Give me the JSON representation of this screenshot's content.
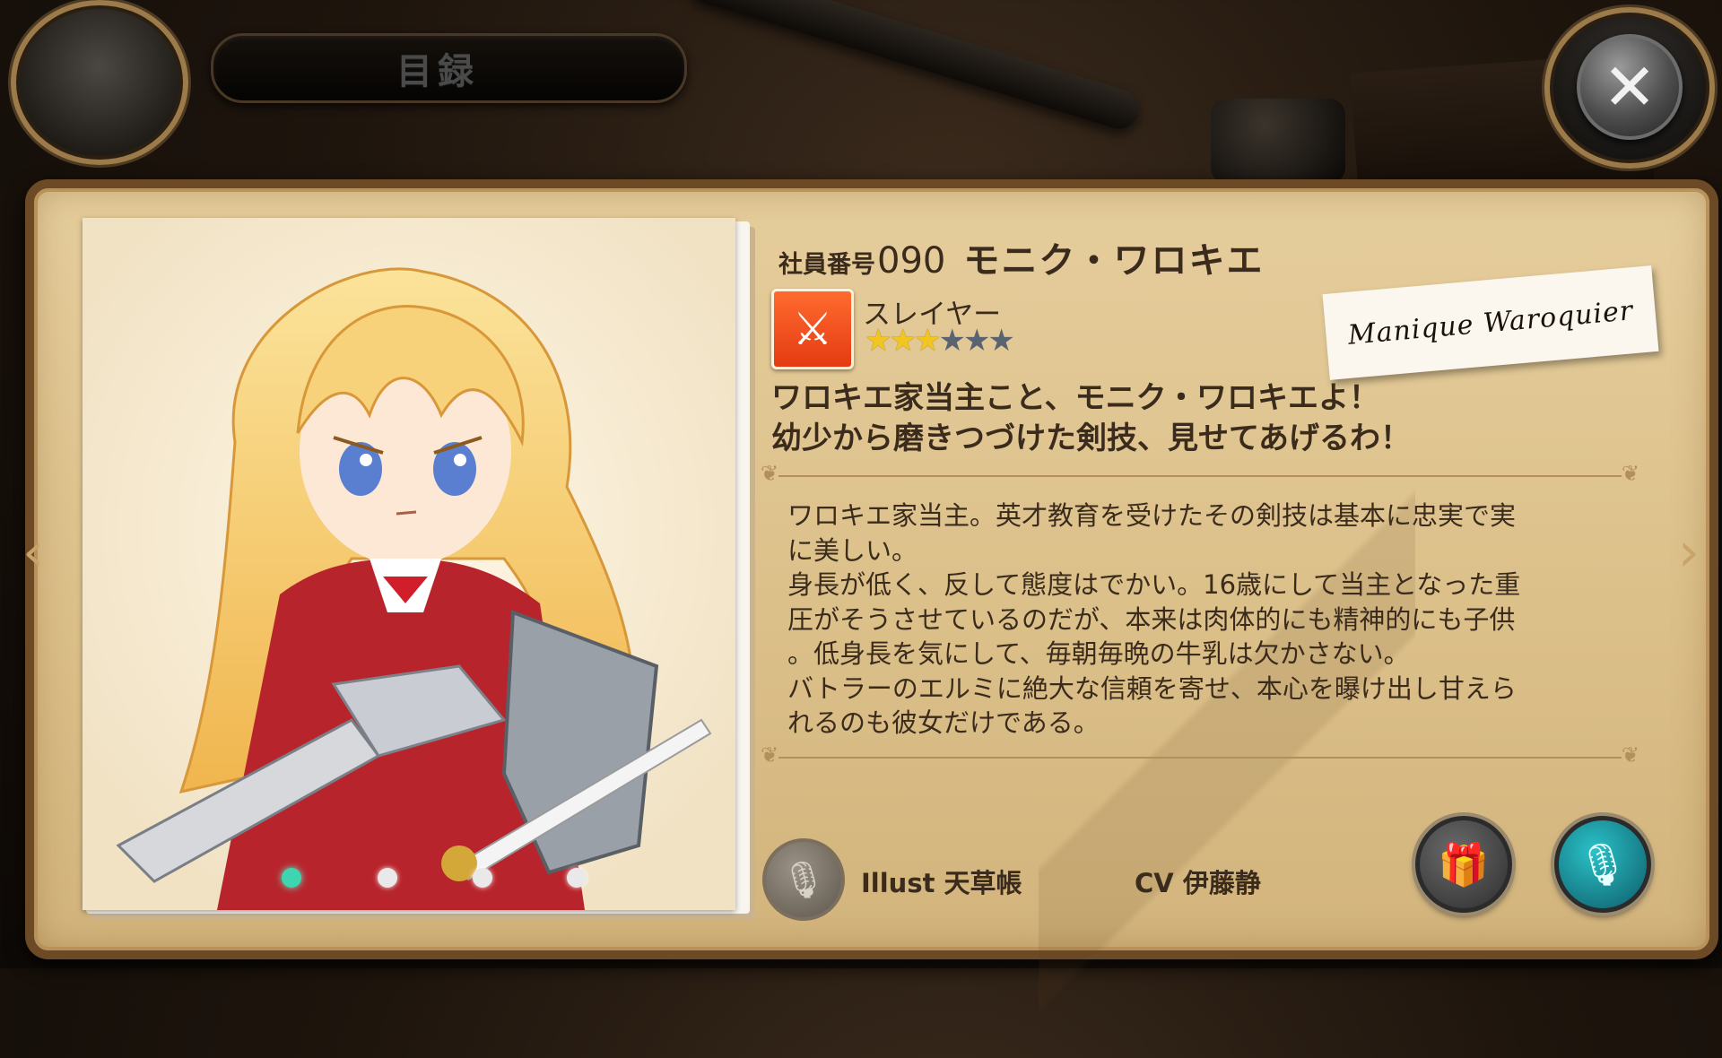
{
  "header": {
    "title": "目録",
    "close_icon": "close-icon"
  },
  "profile": {
    "employee_prefix": "社員番号",
    "employee_number": "090",
    "name": "モニク・ワロキエ",
    "class_name": "スレイヤー",
    "class_icon": "sword-icon",
    "rarity": {
      "filled": 3,
      "total": 6
    },
    "signature": "Manique Waroquier",
    "quote_lines": [
      "ワロキエ家当主こと、モニク・ワロキエよ！",
      "幼少から磨きつづけた剣技、見せてあげるわ！"
    ],
    "description_lines": [
      "ワロキエ家当主。英才教育を受けたその剣技は基本に忠実で実",
      "に美しい。",
      "身長が低く、反して態度はでかい。16歳にして当主となった重",
      "圧がそうさせているのだが、本来は肉体的にも精神的にも子供",
      "。低身長を気にして、毎朝毎晩の牛乳は欠かさない。",
      "バトラーのエルミに絶大な信頼を寄せ、本心を曝け出し甘えら",
      "れるのも彼女だけである。"
    ],
    "illust_credit": "Illust 天草帳",
    "cv_credit": "CV 伊藤静"
  },
  "gallery": {
    "page_count": 4,
    "active_page": 1
  },
  "colors": {
    "panel": "#dcc08a",
    "frame": "#6c4a25",
    "text": "#3a2b1c",
    "accent_teal": "#3dd6b0",
    "class_icon_bg": "#e43b12",
    "star_on": "#f1c620",
    "star_off": "#5a6470"
  },
  "icons": {
    "prev": "chevron-left-icon",
    "next": "chevron-right-icon",
    "mic": "microphone-icon",
    "gift": "gift-icon",
    "voice": "voice-icon"
  }
}
